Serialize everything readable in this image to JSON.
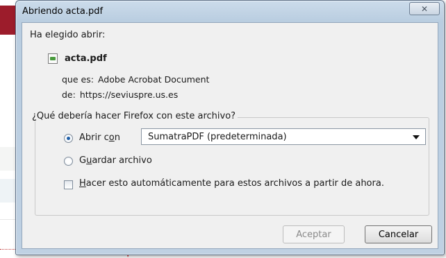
{
  "window": {
    "title": "Abriendo acta.pdf",
    "close_glyph": "✕"
  },
  "dialog": {
    "heading": "Ha elegido abrir:",
    "file_name": "acta.pdf",
    "type_label": "que es:",
    "type_value": "Adobe Acrobat Document",
    "from_label": "de:",
    "from_value": "https://seviuspre.us.es"
  },
  "group": {
    "legend": "¿Qué debería hacer Firefox con este archivo?",
    "open_with": {
      "label_pre": "Abrir c",
      "label_accel": "o",
      "label_post": "n",
      "checked": true,
      "selected_app": "SumatraPDF (predeterminada)"
    },
    "save_file": {
      "label_pre": "G",
      "label_accel": "u",
      "label_post": "ardar archivo",
      "checked": false
    },
    "auto": {
      "label_accel": "H",
      "label_post": "acer esto automáticamente para estos archivos a partir de ahora.",
      "checked": false
    }
  },
  "buttons": {
    "accept": "Aceptar",
    "cancel": "Cancelar"
  },
  "colors": {
    "titlebar": "#bfd1e3",
    "client_bg": "#f0f0f0",
    "background_red": "#9c1c2b",
    "annotation_arrow": "#d21a1a"
  }
}
